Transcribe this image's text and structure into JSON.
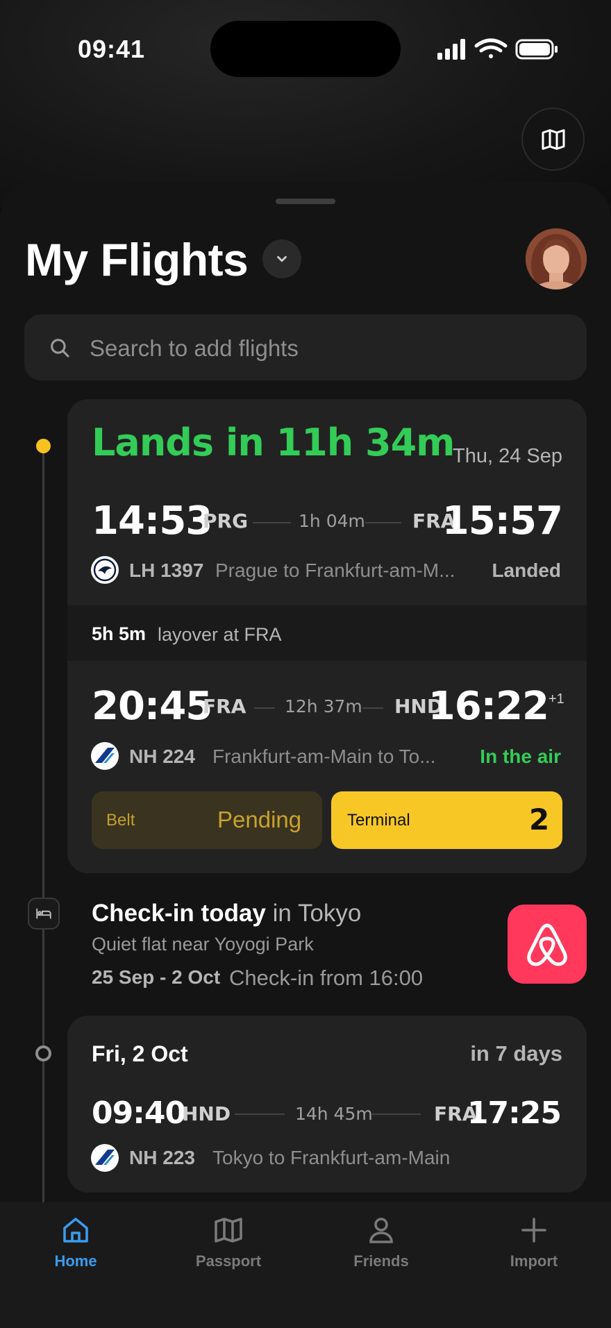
{
  "status_bar": {
    "time": "09:41"
  },
  "header": {
    "title": "My Flights"
  },
  "search": {
    "placeholder": "Search to add flights"
  },
  "upcoming": {
    "countdown": "Lands in 11h 34m",
    "date": "Thu, 24 Sep",
    "flight1": {
      "dep_time": "14:53",
      "dep_airport": "PRG",
      "duration": "1h 04m",
      "arr_airport": "FRA",
      "arr_time": "15:57",
      "flight_no": "LH 1397",
      "route": "Prague to Frankfurt-am-M...",
      "status": "Landed"
    },
    "layover": {
      "duration": "5h 5m",
      "text": "layover at FRA"
    },
    "flight2": {
      "dep_time": "20:45",
      "dep_airport": "FRA",
      "duration": "12h 37m",
      "arr_airport": "HND",
      "arr_time": "16:22",
      "day_offset": "+1",
      "flight_no": "NH 224",
      "route": "Frankfurt-am-Main to To...",
      "status": "In the air",
      "belt_label": "Belt",
      "belt_value": "Pending",
      "terminal_label": "Terminal",
      "terminal_value": "2"
    }
  },
  "stay": {
    "title": "Check-in today",
    "location": "in Tokyo",
    "name": "Quiet flat near Yoyogi Park",
    "dates": "25 Sep - 2 Oct",
    "checkin": "Check-in from 16:00"
  },
  "return_flight": {
    "date": "Fri, 2 Oct",
    "countdown": "in 7 days",
    "dep_time": "09:40",
    "dep_airport": "HND",
    "duration": "14h 45m",
    "arr_airport": "FRA",
    "arr_time": "17:25",
    "flight_no": "NH 223",
    "route": "Tokyo to Frankfurt-am-Main"
  },
  "tabbar": [
    {
      "label": "Home",
      "icon": "home-icon",
      "active": true
    },
    {
      "label": "Passport",
      "icon": "map-icon",
      "active": false
    },
    {
      "label": "Friends",
      "icon": "person-icon",
      "active": false
    },
    {
      "label": "Import",
      "icon": "plus-icon",
      "active": false
    }
  ],
  "colors": {
    "accent_green": "#33cc57",
    "accent_yellow": "#f7c726",
    "accent_blue": "#3a9cf0",
    "airbnb": "#ff385c"
  }
}
